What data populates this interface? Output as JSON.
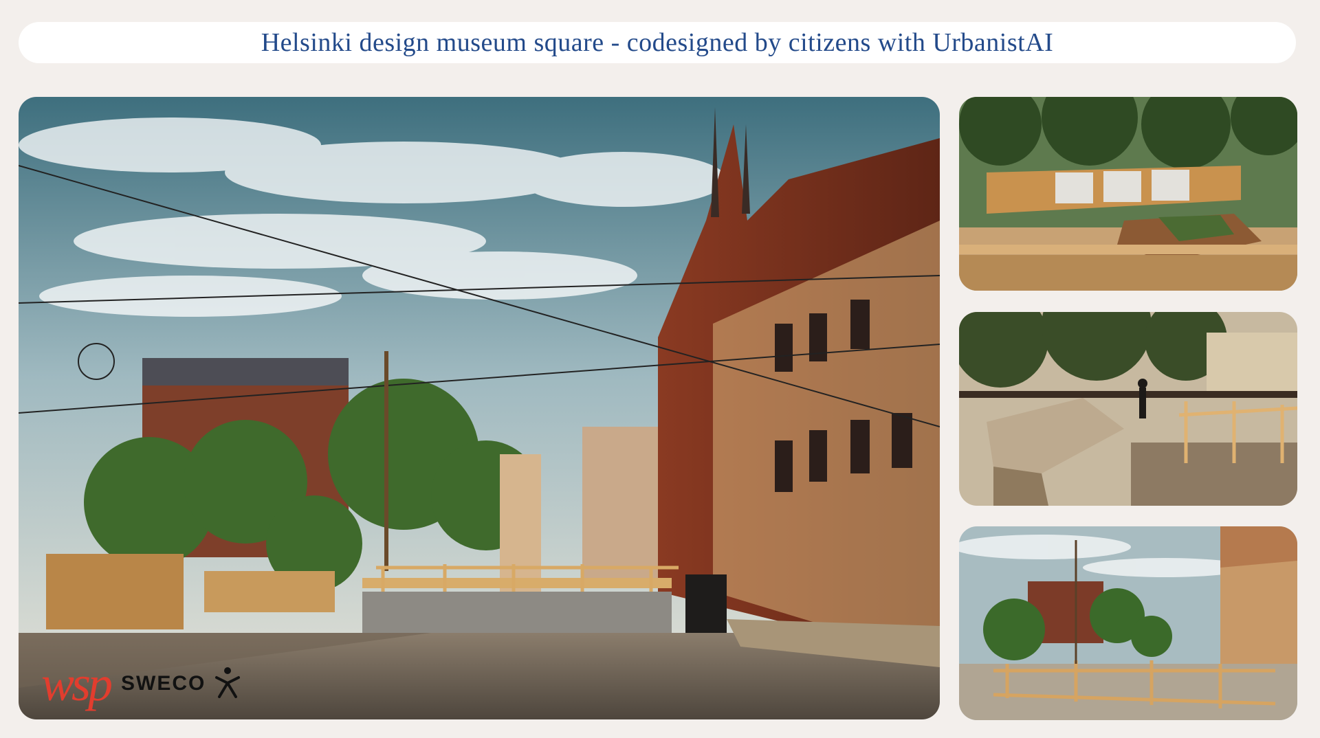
{
  "header": {
    "title": "Helsinki design museum square - codesigned by citizens with UrbanistAI"
  },
  "logos": {
    "wsp": "wsp",
    "sweco": "SWECO"
  },
  "colors": {
    "background": "#f3efec",
    "title_text": "#234a8a",
    "wsp_red": "#e23d2e"
  }
}
